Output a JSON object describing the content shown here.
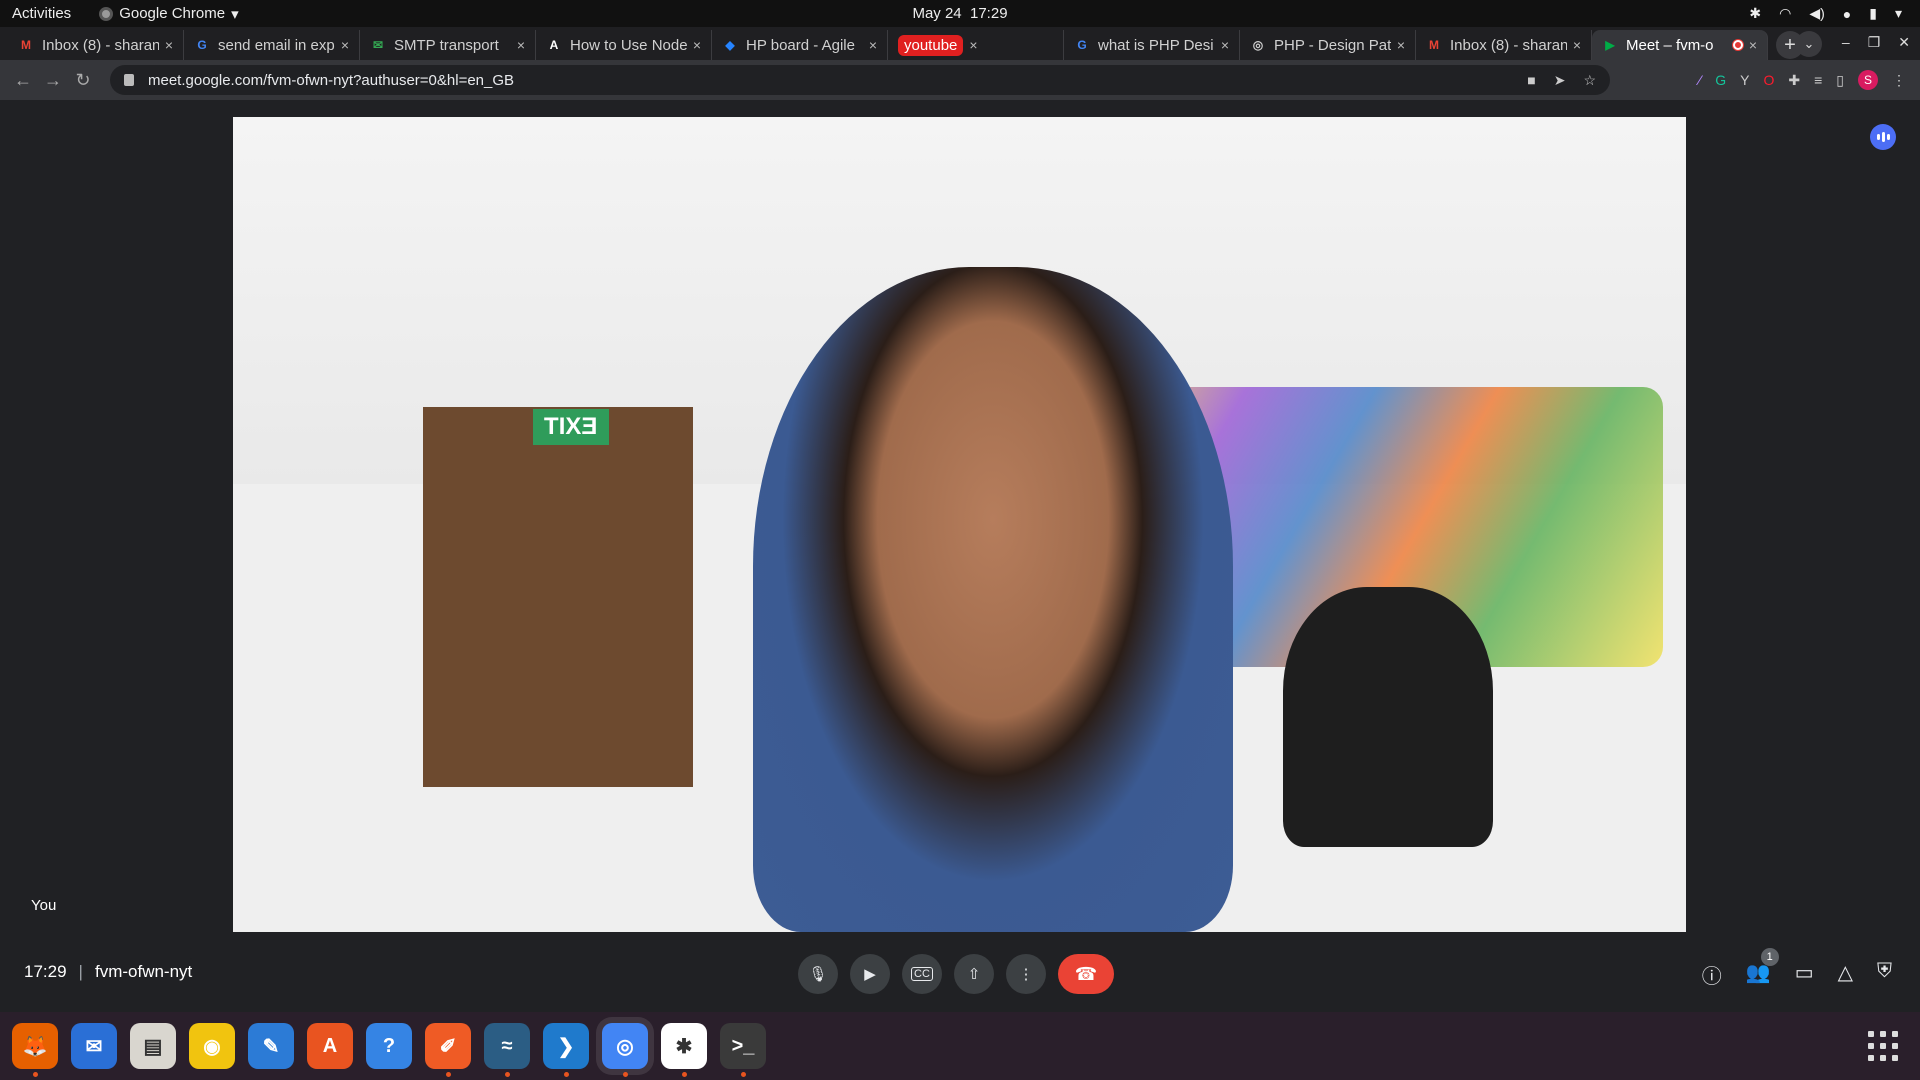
{
  "topbar": {
    "activities": "Activities",
    "app_name": "Google Chrome",
    "date": "May 24",
    "time": "17:29"
  },
  "tabs": [
    {
      "title": "Inbox (8) - sharan",
      "favicon": "gmail-icon",
      "fav_text": "M",
      "fav_color": "#ea4335"
    },
    {
      "title": "send email in expr",
      "favicon": "google-icon",
      "fav_text": "G",
      "fav_color": "#4285f4"
    },
    {
      "title": "SMTP transport",
      "favicon": "nodemailer-icon",
      "fav_text": "✉",
      "fav_color": "#34a853"
    },
    {
      "title": "How to Use Node",
      "favicon": "site-icon",
      "fav_text": "A",
      "fav_color": "#ffffff"
    },
    {
      "title": "HP board - Agile",
      "favicon": "jira-icon",
      "fav_text": "◆",
      "fav_color": "#2684ff"
    },
    {
      "title": "youtube",
      "favicon": "youtube-pill",
      "fav_text": "",
      "fav_color": "#e02020"
    },
    {
      "title": "what is PHP Desi",
      "favicon": "google-icon",
      "fav_text": "G",
      "fav_color": "#4285f4"
    },
    {
      "title": "PHP - Design Patt",
      "favicon": "site-icon",
      "fav_text": "◎",
      "fav_color": "#cccccc"
    },
    {
      "title": "Inbox (8) - sharan",
      "favicon": "gmail-icon",
      "fav_text": "M",
      "fav_color": "#ea4335"
    },
    {
      "title": "Meet – fvm-o",
      "favicon": "meet-icon",
      "fav_text": "▶",
      "fav_color": "#00ac47",
      "active": true,
      "recording": true
    }
  ],
  "omnibox": {
    "url": "meet.google.com/fvm-ofwn-nyt?authuser=0&hl=en_GB"
  },
  "profile": {
    "initial": "S"
  },
  "meet": {
    "self_label": "You",
    "time": "17:29",
    "meeting_code": "fvm-ofwn-nyt",
    "participant_count": "1",
    "exit_sign": "EXIT"
  },
  "controls": {
    "mic": "mic-icon",
    "camera": "camera-icon",
    "captions_label": "CC",
    "present": "present-icon",
    "more": "more-icon",
    "end": "end-call-icon"
  },
  "dock": [
    {
      "name": "firefox",
      "color": "#e66000",
      "glyph": "🦊",
      "running": true
    },
    {
      "name": "thunderbird",
      "color": "#2a6fd6",
      "glyph": "✉",
      "running": false
    },
    {
      "name": "files",
      "color": "#d9d6cf",
      "glyph": "▤",
      "running": false
    },
    {
      "name": "rhythmbox",
      "color": "#f1c40f",
      "glyph": "◉",
      "running": false
    },
    {
      "name": "libreoffice-writer",
      "color": "#2c7bd6",
      "glyph": "✎",
      "running": false
    },
    {
      "name": "software-center",
      "color": "#e95420",
      "glyph": "A",
      "running": false
    },
    {
      "name": "help",
      "color": "#3584e4",
      "glyph": "?",
      "running": false
    },
    {
      "name": "postman",
      "color": "#ef5b25",
      "glyph": "✐",
      "running": true
    },
    {
      "name": "mysql-workbench",
      "color": "#2b5d84",
      "glyph": "≈",
      "running": true
    },
    {
      "name": "vscode",
      "color": "#1f7acc",
      "glyph": "❯",
      "running": true
    },
    {
      "name": "chrome",
      "color": "#4285f4",
      "glyph": "◎",
      "running": true,
      "focused": true
    },
    {
      "name": "slack",
      "color": "#ffffff",
      "glyph": "✱",
      "running": true
    },
    {
      "name": "terminal",
      "color": "#3a3a3a",
      "glyph": ">_",
      "running": true
    }
  ]
}
